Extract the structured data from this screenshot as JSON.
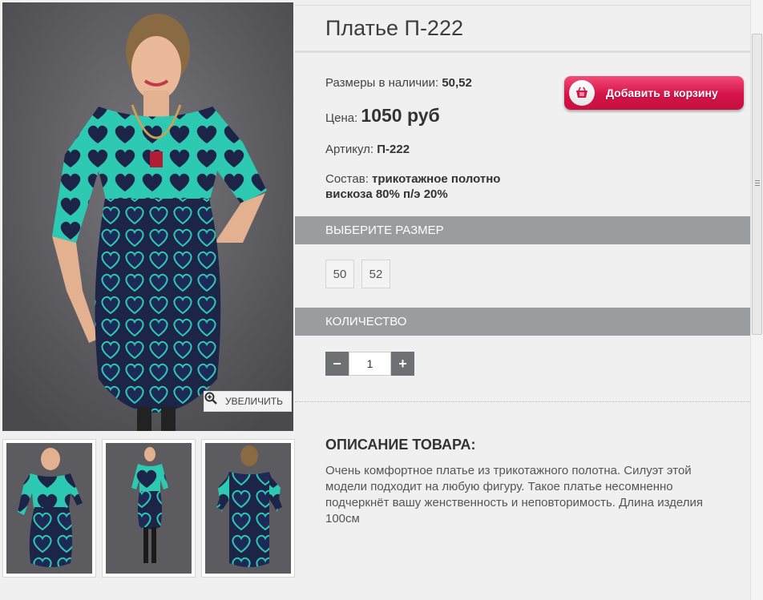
{
  "product": {
    "title": "Платье П-222",
    "sizes_label": "Размеры в наличии:",
    "sizes_value": "50,52",
    "price_label": "Цена:",
    "price_value": "1050 руб",
    "article_label": "Артикул:",
    "article_value": "П-222",
    "composition_label": "Состав:",
    "composition_line1": "трикотажное полотно",
    "composition_line2": "вискоза 80% п/э 20%"
  },
  "cart_button": {
    "label": "Добавить в корзину",
    "icon": "basket-icon",
    "color": "#d41448"
  },
  "gallery": {
    "zoom_label": "УВЕЛИЧИТЬ",
    "zoom_icon": "magnifier-plus-icon",
    "thumbnails": [
      "front-view",
      "full-length-view",
      "back-view"
    ]
  },
  "size_section": {
    "title": "ВЫБЕРИТЕ РАЗМЕР",
    "options": [
      "50",
      "52"
    ]
  },
  "quantity_section": {
    "title": "КОЛИЧЕСТВО",
    "minus": "−",
    "plus": "+",
    "value": "1"
  },
  "description": {
    "title": "ОПИСАНИЕ ТОВАРА:",
    "text": "Очень комфортное платье из трикотажного полотна. Силуэт этой модели подходит на любую фигуру. Такое платье несомненно подчеркнёт вашу женственность и неповторимость. Длина изделия 100см"
  },
  "colors": {
    "section_bar": "#9a9ca0",
    "teal": "#2ec9b3",
    "navy": "#1c2447"
  }
}
